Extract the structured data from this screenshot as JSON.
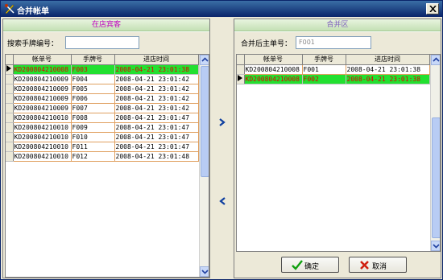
{
  "window": {
    "title": "合并帐单"
  },
  "left_panel": {
    "header": "在店宾客",
    "search_label": "搜索手牌编号：",
    "search_value": "",
    "columns": [
      "帐单号",
      "手牌号",
      "进店时间"
    ],
    "rows": [
      {
        "bill": "KD200804210008",
        "tag": "F003",
        "time": "2008-04-21 23:01:38",
        "selected": true
      },
      {
        "bill": "KD200804210009",
        "tag": "F004",
        "time": "2008-04-21 23:01:42",
        "selected": false
      },
      {
        "bill": "KD200804210009",
        "tag": "F005",
        "time": "2008-04-21 23:01:42",
        "selected": false
      },
      {
        "bill": "KD200804210009",
        "tag": "F006",
        "time": "2008-04-21 23:01:42",
        "selected": false
      },
      {
        "bill": "KD200804210009",
        "tag": "F007",
        "time": "2008-04-21 23:01:42",
        "selected": false
      },
      {
        "bill": "KD200804210010",
        "tag": "F008",
        "time": "2008-04-21 23:01:47",
        "selected": false
      },
      {
        "bill": "KD200804210010",
        "tag": "F009",
        "time": "2008-04-21 23:01:47",
        "selected": false
      },
      {
        "bill": "KD200804210010",
        "tag": "F010",
        "time": "2008-04-21 23:01:47",
        "selected": false
      },
      {
        "bill": "KD200804210010",
        "tag": "F011",
        "time": "2008-04-21 23:01:47",
        "selected": false
      },
      {
        "bill": "KD200804210010",
        "tag": "F012",
        "time": "2008-04-21 23:01:48",
        "selected": false
      }
    ]
  },
  "right_panel": {
    "header": "合并区",
    "main_bill_label": "合并后主单号：",
    "main_bill_value": "F001",
    "columns": [
      "帐单号",
      "手牌号",
      "进店时间"
    ],
    "rows": [
      {
        "bill": "KD200804210008",
        "tag": "F001",
        "time": "2008-04-21 23:01:38",
        "selected": false
      },
      {
        "bill": "KD200804210008",
        "tag": "F002",
        "time": "2008-04-21 23:01:38",
        "selected": true
      }
    ]
  },
  "buttons": {
    "confirm": "确定",
    "cancel": "取消"
  },
  "icons": {
    "app": "app-icon",
    "close": "close-icon",
    "move_right": "chevron-right-icon",
    "move_left": "chevron-left-icon",
    "confirm": "checkmark-icon",
    "cancel": "x-mark-icon"
  },
  "colors": {
    "selected_row_bg": "#22e030",
    "selected_row_text": "#e00000",
    "panel_header_bg": "#c4e0b4",
    "title_bar": "#0a246a"
  }
}
